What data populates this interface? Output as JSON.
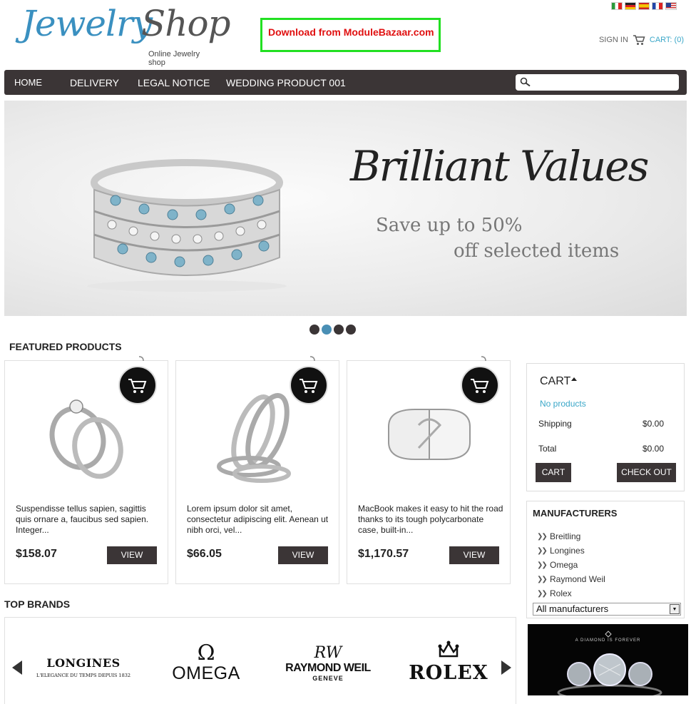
{
  "header": {
    "logo_word_1": "Jewelry",
    "logo_word_2": "Shop",
    "logo_tagline": "Online Jewelry shop",
    "promo_text": "Download from ModuleBazaar.com",
    "sign_in": "SIGN IN",
    "cart_link": "CART: (0)",
    "languages": [
      "it",
      "de",
      "es",
      "fr",
      "en"
    ]
  },
  "nav": {
    "items": [
      "HOME",
      "DELIVERY",
      "LEGAL NOTICE",
      "WEDDING PRODUCT 001"
    ],
    "search_placeholder": ""
  },
  "slider": {
    "title": "Brilliant Values",
    "line1": "Save up to 50%",
    "line2": "off selected items",
    "dot_count": 4,
    "active_dot": 2
  },
  "featured": {
    "title": "FEATURED PRODUCTS",
    "products": [
      {
        "desc": "Suspendisse tellus sapien, sagittis quis ornare a, faucibus sed sapien. Integer...",
        "price": "$158.07",
        "view": "VIEW"
      },
      {
        "desc": "Lorem ipsum dolor sit amet, consectetur adipiscing elit. Aenean ut nibh orci, vel...",
        "price": "$66.05",
        "view": "VIEW"
      },
      {
        "desc": "MacBook makes it easy to hit the road thanks to its tough polycarbonate case, built-in...",
        "price": "$1,170.57",
        "view": "VIEW"
      }
    ]
  },
  "cart_block": {
    "title": "CART",
    "empty": "No products",
    "shipping_label": "Shipping",
    "shipping_value": "$0.00",
    "total_label": "Total",
    "total_value": "$0.00",
    "cart_button": "CART",
    "checkout_button": "CHECK OUT"
  },
  "manufacturers": {
    "title": "MANUFACTURERS",
    "items": [
      "Breitling",
      "Longines",
      "Omega",
      "Raymond Weil",
      "Rolex"
    ],
    "select_value": "All manufacturers"
  },
  "brands": {
    "title": "TOP BRANDS",
    "longines": "LONGINES",
    "longines_sub": "L'ELEGANCE DU TEMPS DEPUIS 1832",
    "omega": "OMEGA",
    "raymond": "RAYMOND WEIL",
    "raymond_sub": "GENEVE",
    "rolex": "ROLEX"
  },
  "promo_banner": {
    "text": "A DIAMOND IS FOREVER"
  },
  "colors": {
    "nav_bg": "#3b3536",
    "accent_blue": "#3aa7c8",
    "promo_red": "#e01010",
    "promo_border": "#22e022"
  }
}
